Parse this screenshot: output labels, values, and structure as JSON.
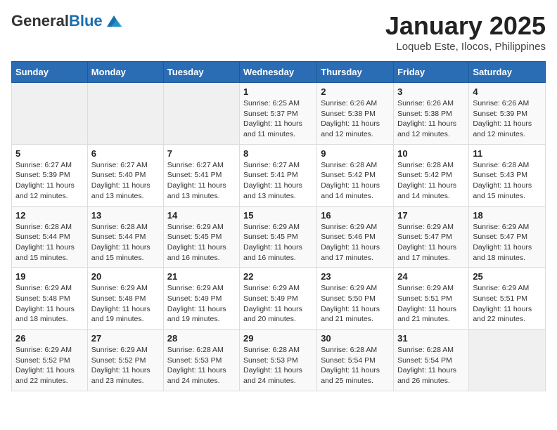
{
  "logo": {
    "general": "General",
    "blue": "Blue"
  },
  "title": "January 2025",
  "subtitle": "Loqueb Este, Ilocos, Philippines",
  "days_of_week": [
    "Sunday",
    "Monday",
    "Tuesday",
    "Wednesday",
    "Thursday",
    "Friday",
    "Saturday"
  ],
  "weeks": [
    [
      {
        "day": "",
        "sunrise": "",
        "sunset": "",
        "daylight": ""
      },
      {
        "day": "",
        "sunrise": "",
        "sunset": "",
        "daylight": ""
      },
      {
        "day": "",
        "sunrise": "",
        "sunset": "",
        "daylight": ""
      },
      {
        "day": "1",
        "sunrise": "Sunrise: 6:25 AM",
        "sunset": "Sunset: 5:37 PM",
        "daylight": "Daylight: 11 hours and 11 minutes."
      },
      {
        "day": "2",
        "sunrise": "Sunrise: 6:26 AM",
        "sunset": "Sunset: 5:38 PM",
        "daylight": "Daylight: 11 hours and 12 minutes."
      },
      {
        "day": "3",
        "sunrise": "Sunrise: 6:26 AM",
        "sunset": "Sunset: 5:38 PM",
        "daylight": "Daylight: 11 hours and 12 minutes."
      },
      {
        "day": "4",
        "sunrise": "Sunrise: 6:26 AM",
        "sunset": "Sunset: 5:39 PM",
        "daylight": "Daylight: 11 hours and 12 minutes."
      }
    ],
    [
      {
        "day": "5",
        "sunrise": "Sunrise: 6:27 AM",
        "sunset": "Sunset: 5:39 PM",
        "daylight": "Daylight: 11 hours and 12 minutes."
      },
      {
        "day": "6",
        "sunrise": "Sunrise: 6:27 AM",
        "sunset": "Sunset: 5:40 PM",
        "daylight": "Daylight: 11 hours and 13 minutes."
      },
      {
        "day": "7",
        "sunrise": "Sunrise: 6:27 AM",
        "sunset": "Sunset: 5:41 PM",
        "daylight": "Daylight: 11 hours and 13 minutes."
      },
      {
        "day": "8",
        "sunrise": "Sunrise: 6:27 AM",
        "sunset": "Sunset: 5:41 PM",
        "daylight": "Daylight: 11 hours and 13 minutes."
      },
      {
        "day": "9",
        "sunrise": "Sunrise: 6:28 AM",
        "sunset": "Sunset: 5:42 PM",
        "daylight": "Daylight: 11 hours and 14 minutes."
      },
      {
        "day": "10",
        "sunrise": "Sunrise: 6:28 AM",
        "sunset": "Sunset: 5:42 PM",
        "daylight": "Daylight: 11 hours and 14 minutes."
      },
      {
        "day": "11",
        "sunrise": "Sunrise: 6:28 AM",
        "sunset": "Sunset: 5:43 PM",
        "daylight": "Daylight: 11 hours and 15 minutes."
      }
    ],
    [
      {
        "day": "12",
        "sunrise": "Sunrise: 6:28 AM",
        "sunset": "Sunset: 5:44 PM",
        "daylight": "Daylight: 11 hours and 15 minutes."
      },
      {
        "day": "13",
        "sunrise": "Sunrise: 6:28 AM",
        "sunset": "Sunset: 5:44 PM",
        "daylight": "Daylight: 11 hours and 15 minutes."
      },
      {
        "day": "14",
        "sunrise": "Sunrise: 6:29 AM",
        "sunset": "Sunset: 5:45 PM",
        "daylight": "Daylight: 11 hours and 16 minutes."
      },
      {
        "day": "15",
        "sunrise": "Sunrise: 6:29 AM",
        "sunset": "Sunset: 5:45 PM",
        "daylight": "Daylight: 11 hours and 16 minutes."
      },
      {
        "day": "16",
        "sunrise": "Sunrise: 6:29 AM",
        "sunset": "Sunset: 5:46 PM",
        "daylight": "Daylight: 11 hours and 17 minutes."
      },
      {
        "day": "17",
        "sunrise": "Sunrise: 6:29 AM",
        "sunset": "Sunset: 5:47 PM",
        "daylight": "Daylight: 11 hours and 17 minutes."
      },
      {
        "day": "18",
        "sunrise": "Sunrise: 6:29 AM",
        "sunset": "Sunset: 5:47 PM",
        "daylight": "Daylight: 11 hours and 18 minutes."
      }
    ],
    [
      {
        "day": "19",
        "sunrise": "Sunrise: 6:29 AM",
        "sunset": "Sunset: 5:48 PM",
        "daylight": "Daylight: 11 hours and 18 minutes."
      },
      {
        "day": "20",
        "sunrise": "Sunrise: 6:29 AM",
        "sunset": "Sunset: 5:48 PM",
        "daylight": "Daylight: 11 hours and 19 minutes."
      },
      {
        "day": "21",
        "sunrise": "Sunrise: 6:29 AM",
        "sunset": "Sunset: 5:49 PM",
        "daylight": "Daylight: 11 hours and 19 minutes."
      },
      {
        "day": "22",
        "sunrise": "Sunrise: 6:29 AM",
        "sunset": "Sunset: 5:49 PM",
        "daylight": "Daylight: 11 hours and 20 minutes."
      },
      {
        "day": "23",
        "sunrise": "Sunrise: 6:29 AM",
        "sunset": "Sunset: 5:50 PM",
        "daylight": "Daylight: 11 hours and 21 minutes."
      },
      {
        "day": "24",
        "sunrise": "Sunrise: 6:29 AM",
        "sunset": "Sunset: 5:51 PM",
        "daylight": "Daylight: 11 hours and 21 minutes."
      },
      {
        "day": "25",
        "sunrise": "Sunrise: 6:29 AM",
        "sunset": "Sunset: 5:51 PM",
        "daylight": "Daylight: 11 hours and 22 minutes."
      }
    ],
    [
      {
        "day": "26",
        "sunrise": "Sunrise: 6:29 AM",
        "sunset": "Sunset: 5:52 PM",
        "daylight": "Daylight: 11 hours and 22 minutes."
      },
      {
        "day": "27",
        "sunrise": "Sunrise: 6:29 AM",
        "sunset": "Sunset: 5:52 PM",
        "daylight": "Daylight: 11 hours and 23 minutes."
      },
      {
        "day": "28",
        "sunrise": "Sunrise: 6:28 AM",
        "sunset": "Sunset: 5:53 PM",
        "daylight": "Daylight: 11 hours and 24 minutes."
      },
      {
        "day": "29",
        "sunrise": "Sunrise: 6:28 AM",
        "sunset": "Sunset: 5:53 PM",
        "daylight": "Daylight: 11 hours and 24 minutes."
      },
      {
        "day": "30",
        "sunrise": "Sunrise: 6:28 AM",
        "sunset": "Sunset: 5:54 PM",
        "daylight": "Daylight: 11 hours and 25 minutes."
      },
      {
        "day": "31",
        "sunrise": "Sunrise: 6:28 AM",
        "sunset": "Sunset: 5:54 PM",
        "daylight": "Daylight: 11 hours and 26 minutes."
      },
      {
        "day": "",
        "sunrise": "",
        "sunset": "",
        "daylight": ""
      }
    ]
  ]
}
